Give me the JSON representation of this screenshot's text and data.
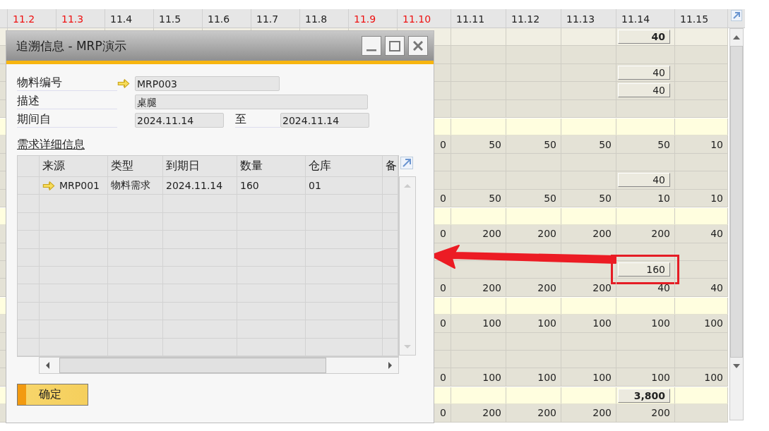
{
  "sheet": {
    "columns": [
      {
        "label": "11.2",
        "weekend": true
      },
      {
        "label": "11.3",
        "weekend": true
      },
      {
        "label": "11.4",
        "weekend": false
      },
      {
        "label": "11.5",
        "weekend": false
      },
      {
        "label": "11.6",
        "weekend": false
      },
      {
        "label": "11.7",
        "weekend": false
      },
      {
        "label": "11.8",
        "weekend": false
      },
      {
        "label": "11.9",
        "weekend": true
      },
      {
        "label": "11.10",
        "weekend": true
      },
      {
        "label": "11.11",
        "weekend": false
      },
      {
        "label": "11.12",
        "weekend": false
      },
      {
        "label": "11.13",
        "weekend": false
      },
      {
        "label": "11.14",
        "weekend": false
      },
      {
        "label": "11.15",
        "weekend": false
      }
    ],
    "rows": [
      {
        "kind": "top",
        "cells": [
          null,
          null,
          null,
          null,
          {
            "text": "40",
            "kind": "button",
            "bold": true
          },
          null
        ]
      },
      {
        "kind": "plain"
      },
      {
        "kind": "plain",
        "cells": [
          null,
          null,
          null,
          null,
          {
            "text": "40",
            "kind": "button"
          },
          null
        ]
      },
      {
        "kind": "plain",
        "cells": [
          null,
          null,
          null,
          null,
          {
            "text": "40",
            "kind": "button"
          },
          null
        ]
      },
      {
        "kind": "plain"
      },
      {
        "kind": "band"
      },
      {
        "kind": "plain",
        "cells": [
          {
            "text": "0"
          },
          {
            "text": "50"
          },
          {
            "text": "50"
          },
          {
            "text": "50"
          },
          {
            "text": "50"
          },
          {
            "text": "10"
          }
        ]
      },
      {
        "kind": "plain"
      },
      {
        "kind": "plain",
        "cells": [
          null,
          null,
          null,
          null,
          {
            "text": "40",
            "kind": "button"
          },
          null
        ]
      },
      {
        "kind": "plain",
        "cells": [
          {
            "text": "0"
          },
          {
            "text": "50"
          },
          {
            "text": "50"
          },
          {
            "text": "50"
          },
          {
            "text": "10"
          },
          {
            "text": "10"
          }
        ]
      },
      {
        "kind": "band"
      },
      {
        "kind": "plain",
        "cells": [
          {
            "text": "0"
          },
          {
            "text": "200"
          },
          {
            "text": "200"
          },
          {
            "text": "200"
          },
          {
            "text": "200"
          },
          {
            "text": "40"
          }
        ]
      },
      {
        "kind": "plain"
      },
      {
        "kind": "plain",
        "cells": [
          null,
          null,
          null,
          null,
          {
            "text": "160",
            "kind": "button",
            "highlighted": true
          },
          null
        ]
      },
      {
        "kind": "plain",
        "cells": [
          {
            "text": "0"
          },
          {
            "text": "200"
          },
          {
            "text": "200"
          },
          {
            "text": "200"
          },
          {
            "text": "40"
          },
          {
            "text": "40"
          }
        ]
      },
      {
        "kind": "band"
      },
      {
        "kind": "plain",
        "cells": [
          {
            "text": "0"
          },
          {
            "text": "100"
          },
          {
            "text": "100"
          },
          {
            "text": "100"
          },
          {
            "text": "100"
          },
          {
            "text": "100"
          }
        ]
      },
      {
        "kind": "plain"
      },
      {
        "kind": "plain"
      },
      {
        "kind": "plain",
        "cells": [
          {
            "text": "0"
          },
          {
            "text": "100"
          },
          {
            "text": "100"
          },
          {
            "text": "100"
          },
          {
            "text": "100"
          },
          {
            "text": "100"
          }
        ]
      },
      {
        "kind": "band",
        "cells": [
          null,
          null,
          null,
          null,
          {
            "text": "3,800",
            "kind": "button",
            "bold": true
          },
          null
        ]
      },
      {
        "kind": "plain",
        "cells": [
          {
            "text": "0"
          },
          {
            "text": "200"
          },
          {
            "text": "200"
          },
          {
            "text": "200"
          },
          {
            "text": "200"
          },
          null
        ]
      }
    ]
  },
  "dialog": {
    "title": "追溯信息 - MRP演示",
    "fields": [
      {
        "label": "物料编号",
        "value": "MRP003",
        "link": true
      },
      {
        "label": "描述",
        "value": "桌腿",
        "link": false
      },
      {
        "label": "期间自",
        "value": "2024.11.14",
        "link": false,
        "to_label": "至",
        "to_value": "2024.11.14"
      }
    ],
    "section_title": "需求详细信息",
    "table": {
      "columns": [
        "来源",
        "类型",
        "到期日",
        "数量",
        "仓库",
        "备"
      ],
      "rows": [
        {
          "cells": [
            "MRP001",
            "物料需求",
            "2024.11.14",
            "160",
            "01"
          ],
          "link": true
        }
      ]
    },
    "ok_button": "确定"
  }
}
